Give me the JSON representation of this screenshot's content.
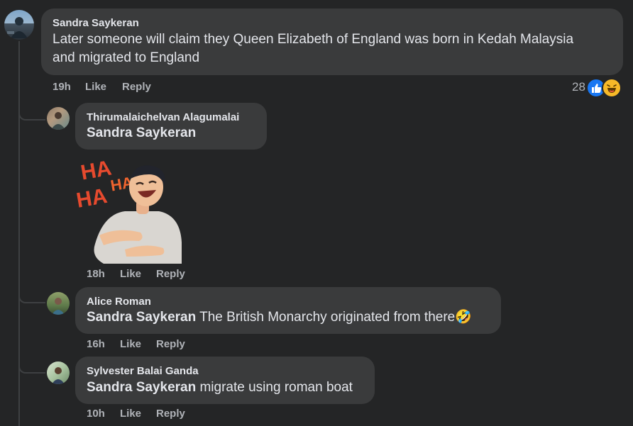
{
  "main_comment": {
    "author": "Sandra Saykeran",
    "text_line1": "Later someone will claim they Queen Elizabeth of England was born in Kedah Malaysia",
    "text_line2": "and migrated to England",
    "time": "19h",
    "like_label": "Like",
    "reply_label": "Reply",
    "reaction_count": "28",
    "reaction_icons": [
      "like-icon",
      "haha-icon"
    ],
    "colors": {
      "like": "#1877f2",
      "haha": "#f7b928"
    }
  },
  "replies": [
    {
      "author": "Thirumalaichelvan Alagumalai",
      "mention": "Sandra Saykeran",
      "text": "",
      "sticker": {
        "icon": "haha-laughing-sticker",
        "letters": [
          "HA",
          "HA",
          "HA"
        ]
      },
      "time": "18h",
      "like_label": "Like",
      "reply_label": "Reply"
    },
    {
      "author": "Alice Roman",
      "mention": "Sandra Saykeran",
      "text": " The British Monarchy originated from there🤣",
      "time": "16h",
      "like_label": "Like",
      "reply_label": "Reply"
    },
    {
      "author": "Sylvester Balai Ganda",
      "mention": "Sandra Saykeran",
      "text": " migrate using roman boat",
      "time": "10h",
      "like_label": "Like",
      "reply_label": "Reply"
    }
  ]
}
